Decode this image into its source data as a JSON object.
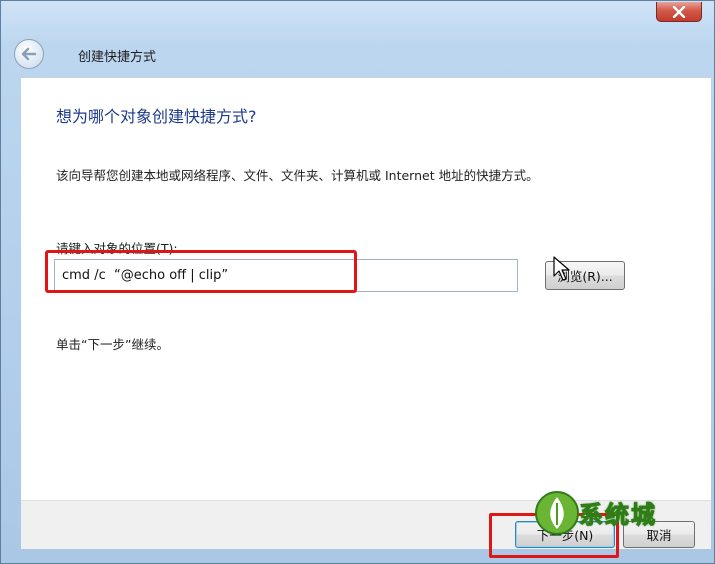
{
  "window": {
    "title": "创建快捷方式",
    "close_icon": "close-icon",
    "back_icon": "back-arrow-icon"
  },
  "main": {
    "heading": "想为哪个对象创建快捷方式?",
    "description": "该向导帮您创建本地或网络程序、文件、文件夹、计算机或 Internet 地址的快捷方式。",
    "field_label": "请键入对象的位置(T):",
    "field_value": "cmd /c  “@echo off | clip”",
    "browse_label": "浏览(R)...",
    "continue_text": "单击“下一步”继续。"
  },
  "footer": {
    "next_label": "下一步(N)",
    "cancel_label": "取消"
  },
  "watermark": {
    "text": "系统城"
  },
  "colors": {
    "heading": "#1e3b8c",
    "highlight": "#e01616",
    "close_button": "#c23b2c",
    "watermark_green": "#2e7d16"
  }
}
